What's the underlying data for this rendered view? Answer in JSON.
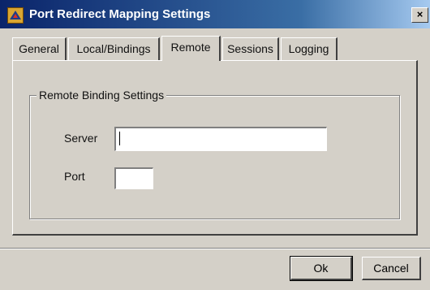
{
  "window": {
    "title": "Port Redirect Mapping Settings",
    "close_label": "×",
    "icon": "port-redirect-app-icon"
  },
  "tabs": [
    {
      "label": "General",
      "active": false
    },
    {
      "label": "Local/Bindings",
      "active": false
    },
    {
      "label": "Remote",
      "active": true
    },
    {
      "label": "Sessions",
      "active": false
    },
    {
      "label": "Logging",
      "active": false
    }
  ],
  "remote_group": {
    "legend": "Remote Binding Settings",
    "server_label": "Server",
    "server_value": "",
    "port_label": "Port",
    "port_value": ""
  },
  "buttons": {
    "ok_label": "Ok",
    "cancel_label": "Cancel"
  },
  "colors": {
    "titlebar_start": "#0a246a",
    "titlebar_end": "#a6caf0",
    "dialog_face": "#d4d0c8"
  }
}
